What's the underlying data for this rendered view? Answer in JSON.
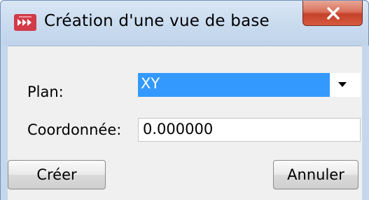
{
  "window": {
    "title": "Création d'une vue de base",
    "close_symbol": "✕"
  },
  "form": {
    "plan_label": "Plan:",
    "plan_value": "XY",
    "coord_label": "Coordonnée:",
    "coord_value": "0.000000"
  },
  "buttons": {
    "create_label": "Créer",
    "cancel_label": "Annuler"
  },
  "icons": {
    "app": "app-logo-icon",
    "dropdown": "chevron-down-icon",
    "close": "close-icon"
  },
  "colors": {
    "selection": "#3399ff",
    "close_button": "#c5412b",
    "title_bar": "#c9dbef"
  }
}
